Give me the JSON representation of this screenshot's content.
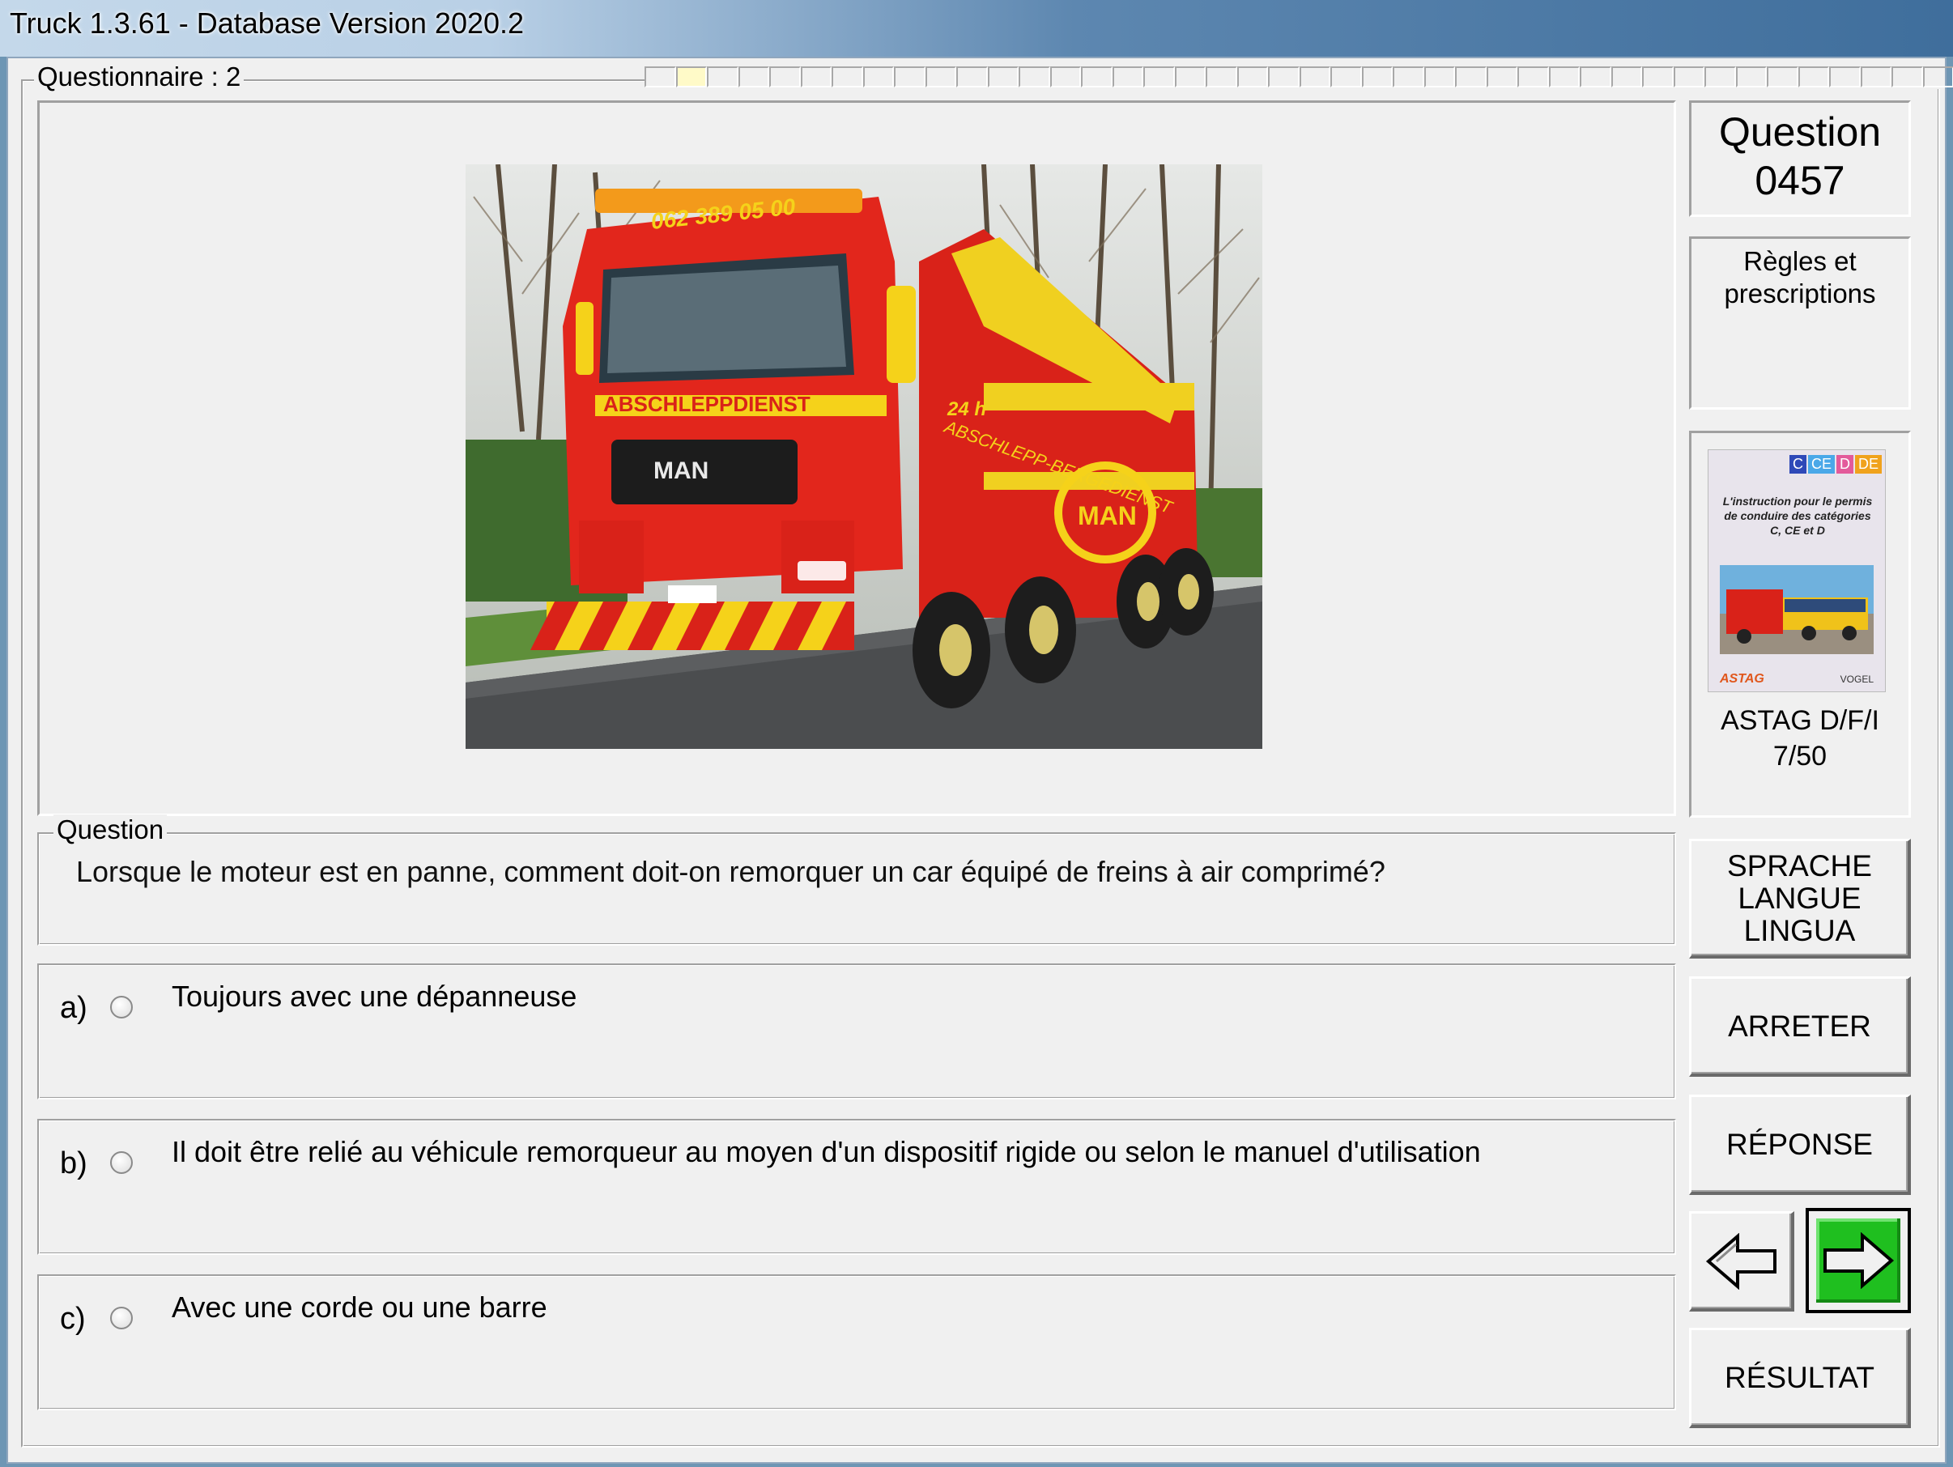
{
  "window": {
    "title": "Truck 1.3.61 - Database Version 2020.2"
  },
  "questionnaire": {
    "label": "Questionnaire : 2",
    "segments": 26,
    "active_segment": 1
  },
  "photo": {
    "plate_phone": "062 389 05 00",
    "side_text": "ABSCHLEPPDIENST",
    "side_text2": "ABSCHLEPP-BERGEDIENST",
    "brand": "MAN",
    "hours": "24 h"
  },
  "question_panel": {
    "number_label": "Question",
    "number": "0457",
    "category": "Règles et prescriptions"
  },
  "book": {
    "badges": [
      "C",
      "CE",
      "D",
      "DE"
    ],
    "cover_text": "L'instruction pour le permis de conduire des catégories C, CE et D",
    "logo_left": "ASTAG",
    "logo_right": "VOGEL",
    "source": "ASTAG D/F/I",
    "page": "7/50"
  },
  "question": {
    "legend": "Question",
    "text": "Lorsque le moteur est en panne, comment doit-on remorquer un car équipé de freins à air comprimé?"
  },
  "answers": [
    {
      "letter": "a)",
      "text": "Toujours avec une dépanneuse"
    },
    {
      "letter": "b)",
      "text": "Il doit être relié au véhicule remorqueur au moyen d'un dispositif rigide ou  selon le manuel d'utilisation"
    },
    {
      "letter": "c)",
      "text": "Avec une corde ou une barre"
    }
  ],
  "buttons": {
    "language": [
      "SPRACHE",
      "LANGUE",
      "LINGUA"
    ],
    "stop": "ARRETER",
    "answer": "RÉPONSE",
    "result": "RÉSULTAT"
  },
  "colors": {
    "next_button": "#1fbf1f",
    "truck_red": "#e2261c",
    "stripe_yellow": "#f5d21a"
  }
}
